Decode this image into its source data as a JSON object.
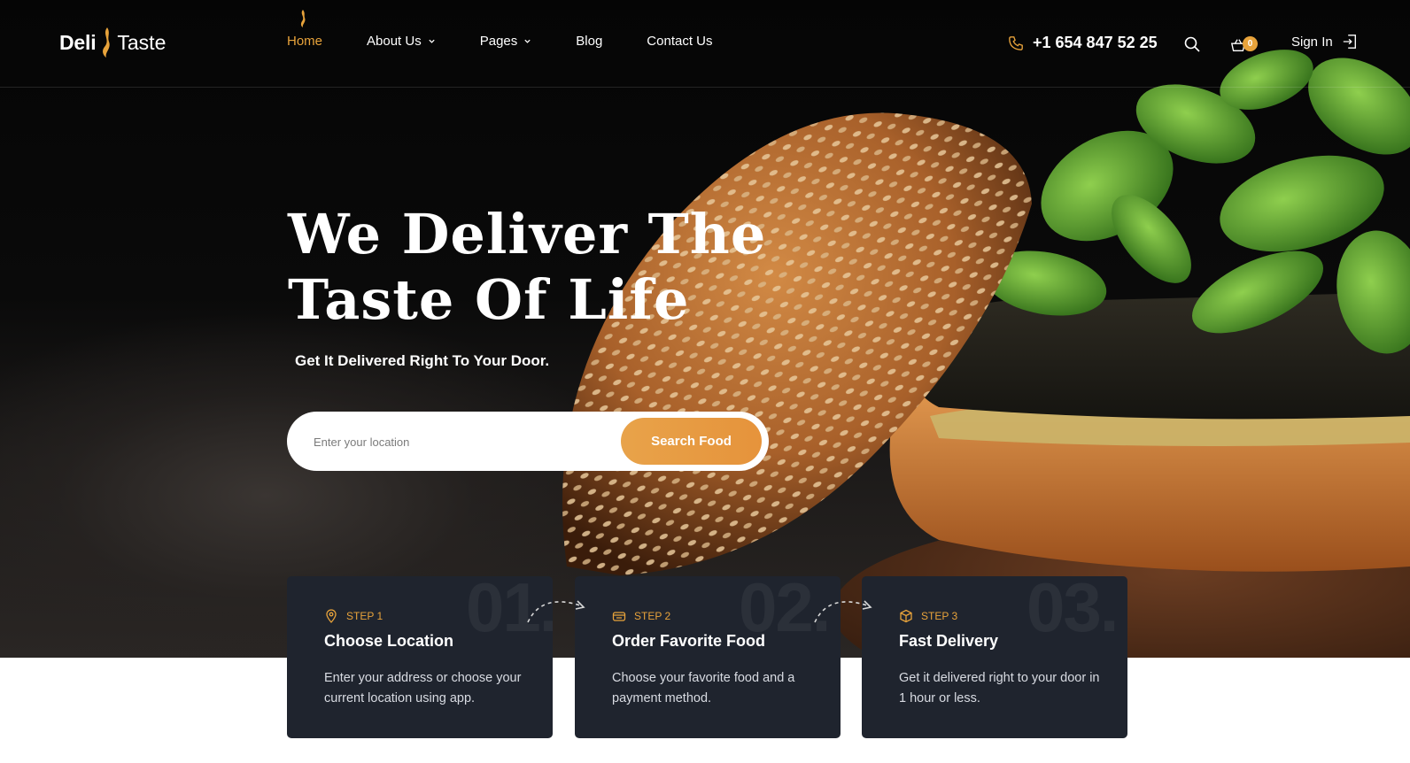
{
  "brand": {
    "name_bold": "Deli",
    "name_light": "Taste"
  },
  "nav": {
    "items": [
      {
        "label": "Home",
        "active": true,
        "has_dropdown": false
      },
      {
        "label": "About Us",
        "active": false,
        "has_dropdown": true
      },
      {
        "label": "Pages",
        "active": false,
        "has_dropdown": true
      },
      {
        "label": "Blog",
        "active": false,
        "has_dropdown": false
      },
      {
        "label": "Contact Us",
        "active": false,
        "has_dropdown": false
      }
    ]
  },
  "header": {
    "phone": "+1 654 847 52 25",
    "cart_count": "0",
    "sign_in_label": "Sign In"
  },
  "hero": {
    "title_line1": "We Deliver The",
    "title_line2": "Taste Of Life",
    "subtitle": "Get It Delivered Right To Your Door.",
    "search_placeholder": "Enter your location",
    "search_button": "Search Food"
  },
  "steps": [
    {
      "number": "01.",
      "label": "STEP 1",
      "title": "Choose Location",
      "description": "Enter your address or choose your current location using app.",
      "icon": "location-pin-icon"
    },
    {
      "number": "02.",
      "label": "STEP 2",
      "title": "Order Favorite Food",
      "description": "Choose your favorite food and a payment method.",
      "icon": "food-box-icon"
    },
    {
      "number": "03.",
      "label": "STEP 3",
      "title": "Fast Delivery",
      "description": "Get it delivered right to your door in 1 hour or less.",
      "icon": "package-icon"
    }
  ],
  "colors": {
    "accent": "#e8a33b",
    "header_bg": "#050505",
    "card_bg": "#1f242e",
    "page_bg": "#ffffff"
  }
}
